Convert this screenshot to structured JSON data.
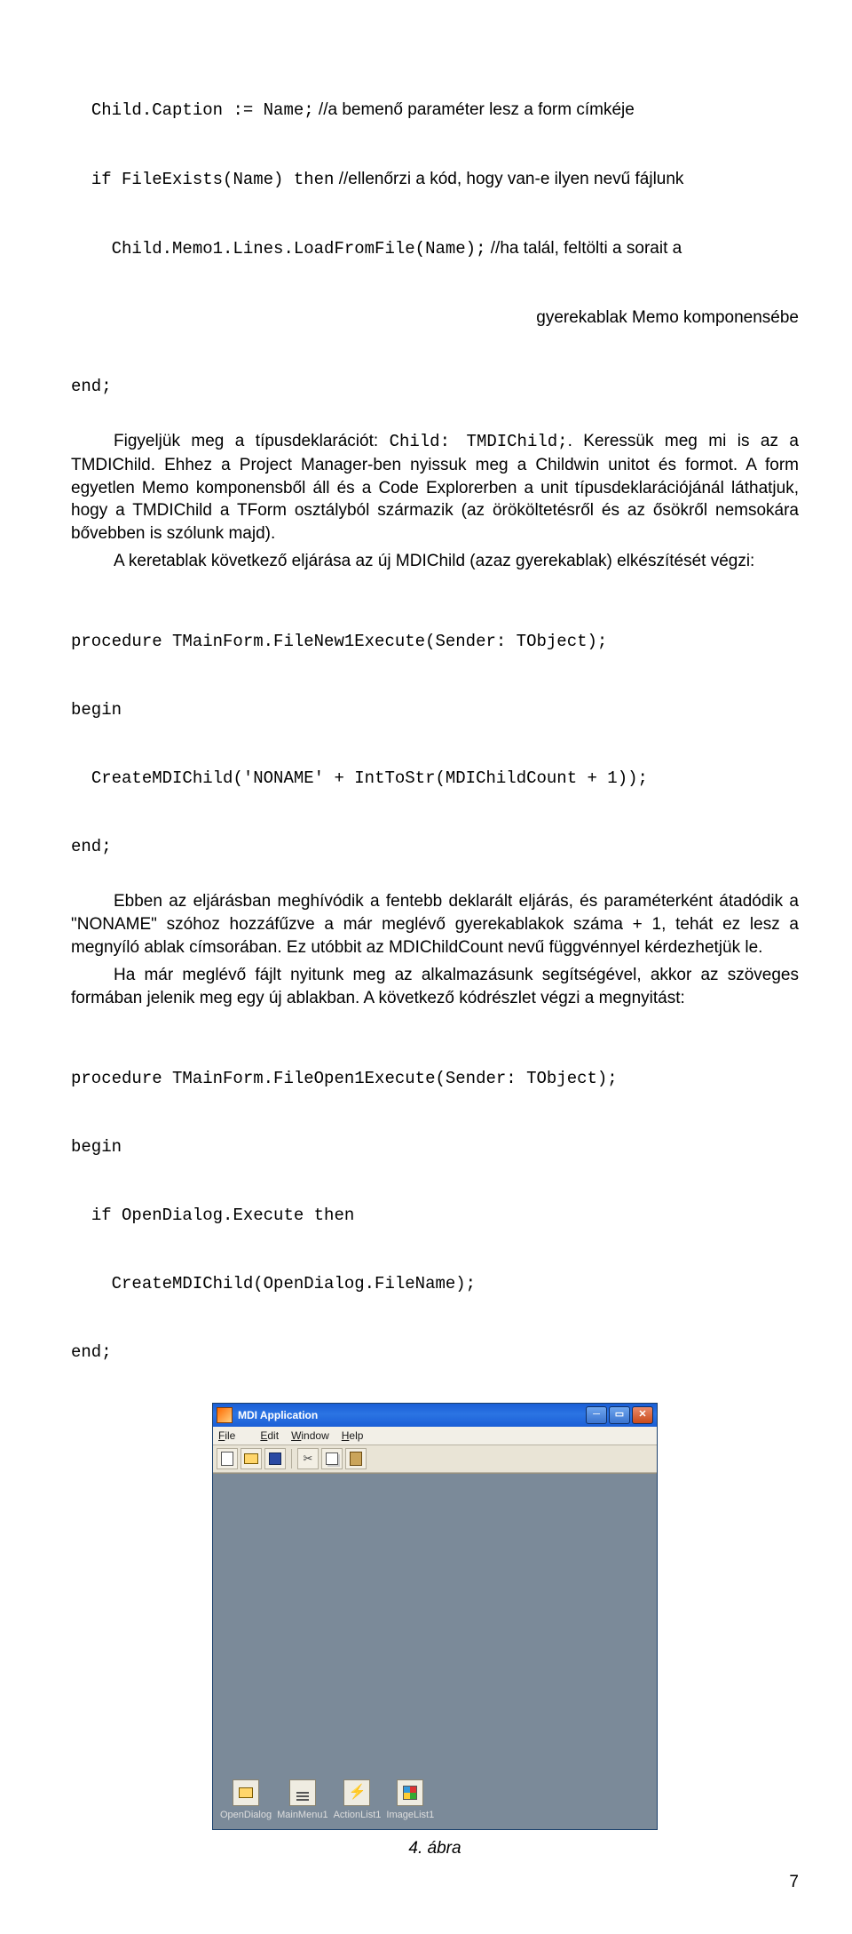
{
  "code1": {
    "l1a": "  Child.Caption := Name;",
    "l1b": " //a bemenő paraméter lesz a form címkéje",
    "l2a": "  if FileExists(Name) then",
    "l2b": " //ellenőrzi a kód, hogy van-e ilyen nevű fájlunk",
    "l3a": "    Child.Memo1.Lines.LoadFromFile(Name);",
    "l3b": " //ha talál, feltölti a sorait a",
    "l4b": "gyerekablak Memo komponensébe",
    "l5": "end;"
  },
  "para1": {
    "t1": "Figyeljük meg a típusdeklarációt: ",
    "c1": "Child: TMDIChild;",
    "t2": ". Keressük meg mi is az a TMDIChild. Ehhez a Project Manager-ben nyissuk meg a Childwin unitot és formot. A form egyetlen Memo komponensből áll és a Code Explorerben a unit típusdeklarációjánál láthatjuk, hogy a TMDIChild a TForm osztályból származik (az örököltetésről és az ősökről nemsokára bővebben is szólunk majd)."
  },
  "para2": "A keretablak következő eljárása az új MDIChild (azaz gyerekablak) elkészítését végzi:",
  "code2": {
    "l1": "procedure TMainForm.FileNew1Execute(Sender: TObject);",
    "l2": "begin",
    "l3": "  CreateMDIChild('NONAME' + IntToStr(MDIChildCount + 1));",
    "l4": "end;"
  },
  "para3": "Ebben az eljárásban meghívódik a fentebb deklarált eljárás, és paraméterként átadódik a \"NONAME\" szóhoz hozzáfűzve a már meglévő gyerekablakok száma + 1, tehát ez lesz a megnyíló ablak címsorában. Ez utóbbit az MDIChildCount nevű függvénnyel kérdezhetjük le.",
  "para4": "Ha már meglévő fájlt nyitunk meg az alkalmazásunk segítségével, akkor az szöveges formában jelenik meg egy új ablakban. A következő kódrészlet végzi a megnyitást:",
  "code3": {
    "l1": "procedure TMainForm.FileOpen1Execute(Sender: TObject);",
    "l2": "begin",
    "l3": "  if OpenDialog.Execute then",
    "l4": "    CreateMDIChild(OpenDialog.FileName);",
    "l5": "end;"
  },
  "window": {
    "title": "MDI Application",
    "menus": {
      "file": "File",
      "edit": "Edit",
      "window": "Window",
      "help": "Help"
    },
    "components": [
      "OpenDialog",
      "MainMenu1",
      "ActionList1",
      "ImageList1"
    ]
  },
  "figcaption": "4. ábra",
  "pagenum": "7"
}
